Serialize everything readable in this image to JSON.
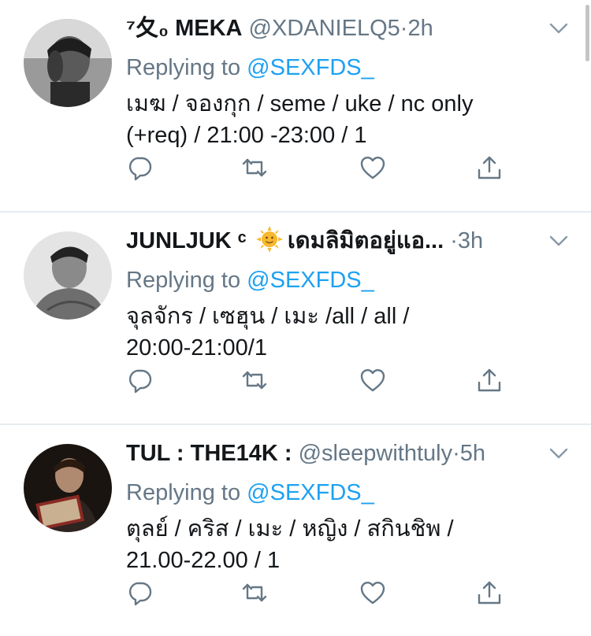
{
  "colors": {
    "link_blue": "#1da1f2",
    "secondary_gray": "#657786",
    "text_dark": "#14171a",
    "divider": "#e6ecf0"
  },
  "tweets": [
    {
      "display_name": "⁷夂₀ MEKA",
      "handle": "@XDANIELQ5",
      "separator": "·",
      "time": "2h",
      "emoji": "",
      "replying_label": "Replying to",
      "replying_to": "@SEXFDS_",
      "text": "เมฆ / จองกุก / seme / uke / nc only\n(+req) / 21:00 -23:00 / 1",
      "avatar_icon": "profile-photo"
    },
    {
      "display_name": "JUNLJUK ᶜ",
      "handle": "เดมลิมิตอยู่แอ...",
      "separator": "·",
      "time": "3h",
      "emoji": "sun-with-face-emoji",
      "replying_label": "Replying to",
      "replying_to": "@SEXFDS_",
      "text": "จุลจักร / เซฮุน / เมะ /all / all /\n20:00-21:00/1",
      "avatar_icon": "profile-photo"
    },
    {
      "display_name": "TUL : THE14K :",
      "handle": "@sleepwithtuly",
      "separator": "·",
      "time": "5h",
      "emoji": "",
      "replying_label": "Replying to",
      "replying_to": "@SEXFDS_",
      "text": "ตุลย์ / คริส / เมะ / หญิง / สกินชิพ /\n21.00-22.00 / 1",
      "avatar_icon": "profile-photo"
    }
  ],
  "action_icons": [
    "reply-icon",
    "retweet-icon",
    "like-icon",
    "share-icon"
  ]
}
